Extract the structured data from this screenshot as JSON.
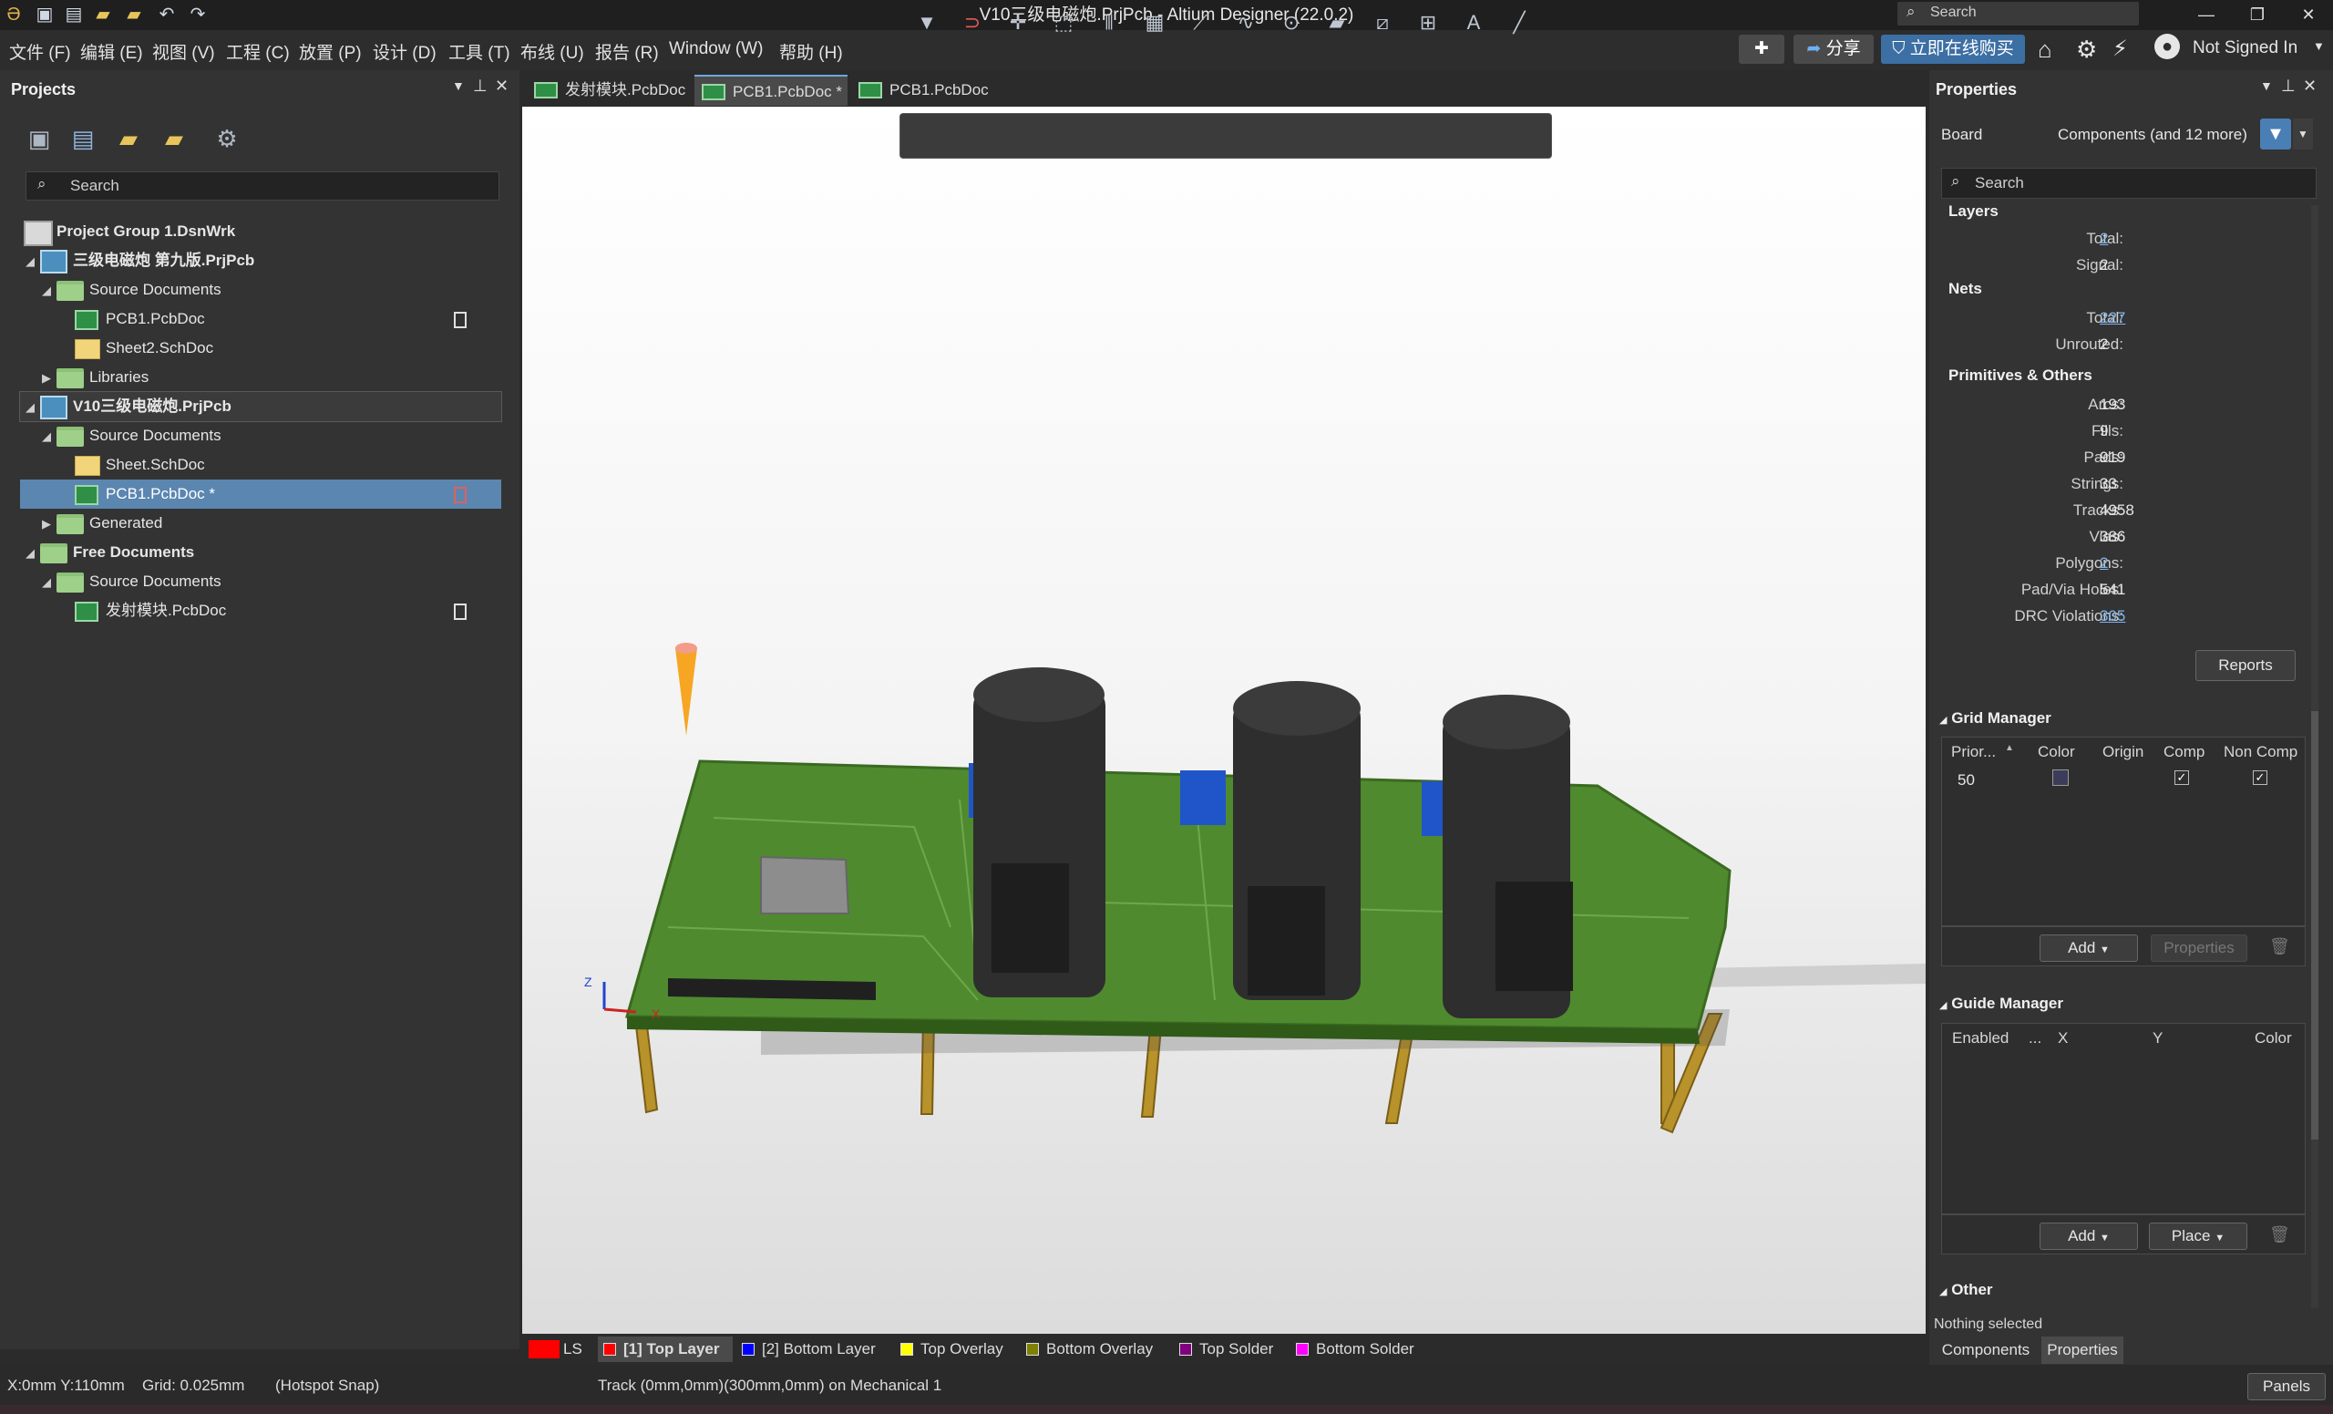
{
  "window": {
    "title": "V10三级电磁炮.PrjPcb - Altium Designer (22.0.2)",
    "search_placeholder": "Search",
    "controls": [
      "—",
      "❐",
      "✕"
    ]
  },
  "menu": [
    "文件 (F)",
    "编辑 (E)",
    "视图 (V)",
    "工程 (C)",
    "放置 (P)",
    "设计 (D)",
    "工具 (T)",
    "布线 (U)",
    "报告 (R)",
    "Window (W)",
    "帮助 (H)"
  ],
  "header_buttons": {
    "share": "分享",
    "buy": "立即在线购买",
    "user": "Not Signed In"
  },
  "projects_panel": {
    "title": "Projects",
    "search_placeholder": "Search",
    "tree": [
      {
        "label": "Project Group 1.DsnWrk",
        "type": "group",
        "level": 0
      },
      {
        "label": "三级电磁炮 第九版.PrjPcb",
        "type": "project",
        "level": 0,
        "expanded": true
      },
      {
        "label": "Source Documents",
        "type": "folder",
        "level": 1,
        "expanded": true
      },
      {
        "label": "PCB1.PcbDoc",
        "type": "pcb",
        "level": 2,
        "docmark": true
      },
      {
        "label": "Sheet2.SchDoc",
        "type": "sch",
        "level": 2
      },
      {
        "label": "Libraries",
        "type": "folder",
        "level": 1,
        "expanded": false
      },
      {
        "label": "V10三级电磁炮.PrjPcb",
        "type": "project",
        "level": 0,
        "expanded": true,
        "active": true
      },
      {
        "label": "Source Documents",
        "type": "folder",
        "level": 1,
        "expanded": true
      },
      {
        "label": "Sheet.SchDoc",
        "type": "sch",
        "level": 2
      },
      {
        "label": "PCB1.PcbDoc *",
        "type": "pcb",
        "level": 2,
        "selected": true,
        "docmark": true
      },
      {
        "label": "Generated",
        "type": "folder",
        "level": 1,
        "expanded": false
      },
      {
        "label": "Free Documents",
        "type": "folder",
        "level": 0,
        "expanded": true
      },
      {
        "label": "Source Documents",
        "type": "folder",
        "level": 1,
        "expanded": true
      },
      {
        "label": "发射模块.PcbDoc",
        "type": "pcb",
        "level": 2,
        "docmark": true
      }
    ]
  },
  "doc_tabs": [
    {
      "label": "发射模块.PcbDoc",
      "active": false
    },
    {
      "label": "PCB1.PcbDoc *",
      "active": true
    },
    {
      "label": "PCB1.PcbDoc",
      "active": false
    }
  ],
  "layer_tabs": {
    "ls": "LS",
    "layers": [
      {
        "label": "[1] Top Layer",
        "color": "#ff0000",
        "active": true
      },
      {
        "label": "[2] Bottom Layer",
        "color": "#0000ff"
      },
      {
        "label": "Top Overlay",
        "color": "#ffff00"
      },
      {
        "label": "Bottom Overlay",
        "color": "#808000"
      },
      {
        "label": "Top Solder",
        "color": "#800080"
      },
      {
        "label": "Bottom Solder",
        "color": "#ff00ff"
      }
    ]
  },
  "properties": {
    "title": "Properties",
    "board_label": "Board",
    "filter_label": "Components (and 12 more)",
    "search_placeholder": "Search",
    "layers_head": "Layers",
    "layers": [
      {
        "label": "Total:",
        "value": "2",
        "link": true
      },
      {
        "label": "Signal:",
        "value": "2"
      }
    ],
    "nets_head": "Nets",
    "nets": [
      {
        "label": "Total:",
        "value": "227",
        "link": true
      },
      {
        "label": "Unrouted:",
        "value": "2"
      }
    ],
    "prim_head": "Primitives & Others",
    "primitives": [
      {
        "label": "Arcs:",
        "value": "193"
      },
      {
        "label": "Fills:",
        "value": "9"
      },
      {
        "label": "Pads:",
        "value": "919"
      },
      {
        "label": "Strings:",
        "value": "33"
      },
      {
        "label": "Tracks:",
        "value": "4958"
      },
      {
        "label": "Vias:",
        "value": "386"
      },
      {
        "label": "Polygons:",
        "value": "2",
        "link": true
      },
      {
        "label": "Pad/Via Holes:",
        "value": "541"
      },
      {
        "label": "DRC Violations:",
        "value": "305",
        "link": true
      }
    ],
    "reports_btn": "Reports",
    "grid_manager": {
      "head": "Grid Manager",
      "columns": [
        "Prior...",
        "Color",
        "Origin",
        "Comp",
        "Non Comp"
      ],
      "row": {
        "priority": "50",
        "comp": true,
        "noncomp": true
      },
      "add": "Add",
      "properties": "Properties"
    },
    "guide_manager": {
      "head": "Guide Manager",
      "columns": [
        "Enabled",
        "...",
        "X",
        "Y",
        "Color"
      ],
      "add": "Add",
      "place": "Place"
    },
    "other_head": "Other",
    "nothing_selected": "Nothing selected",
    "bottom_tabs": [
      "Components",
      "Properties"
    ]
  },
  "status": {
    "coords": "X:0mm Y:110mm",
    "grid": "Grid: 0.025mm",
    "snap": "(Hotspot Snap)",
    "track": "Track (0mm,0mm)(300mm,0mm) on Mechanical 1",
    "panels": "Panels"
  }
}
